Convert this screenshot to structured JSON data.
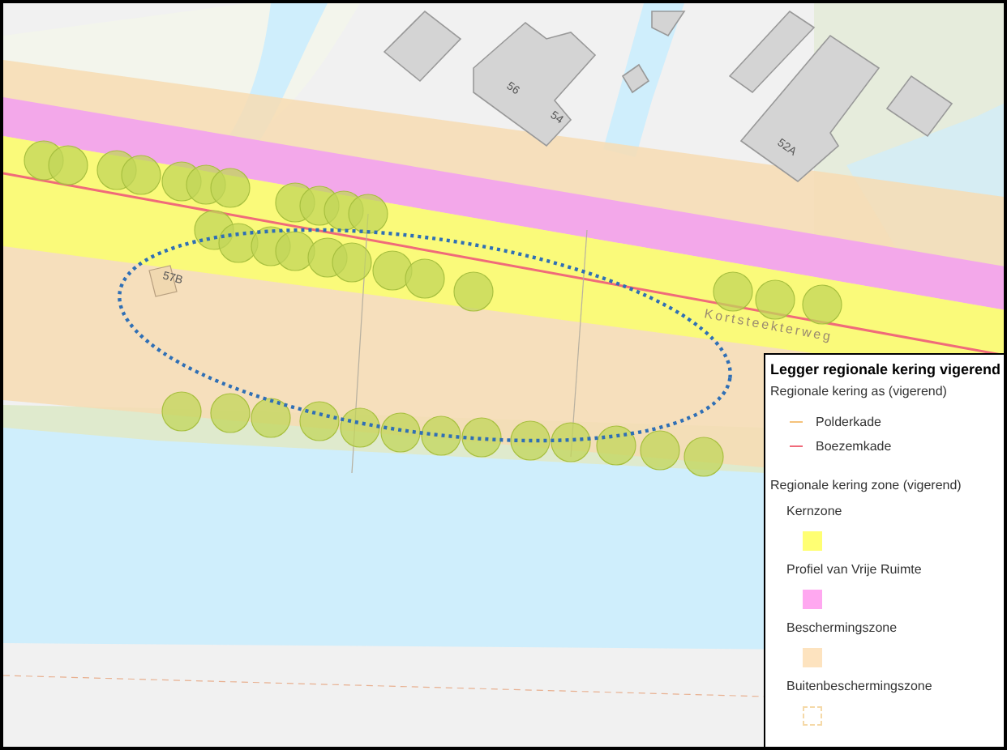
{
  "map": {
    "labels": [
      {
        "kind": "house",
        "text": "56"
      },
      {
        "kind": "house",
        "text": "54"
      },
      {
        "kind": "house",
        "text": "52A"
      },
      {
        "kind": "house",
        "text": "57B"
      },
      {
        "kind": "street",
        "text": "Kortsteekterweg"
      }
    ]
  },
  "legend": {
    "title": "Legger regionale kering vigerend",
    "groups": [
      {
        "title": "Regionale kering as (vigerend)",
        "items": [
          {
            "kind": "line",
            "label": "Polderkade",
            "color": "#f5c27a"
          },
          {
            "kind": "line",
            "label": "Boezemkade",
            "color": "#f06a7a"
          }
        ]
      },
      {
        "title": "Regionale kering zone (vigerend)",
        "items": [
          {
            "kind": "swatch",
            "label": "Kernzone",
            "color": "#ffff73"
          },
          {
            "kind": "swatch",
            "label": "Profiel van Vrije Ruimte",
            "color": "#ffa8f0"
          },
          {
            "kind": "swatch",
            "label": "Beschermingszone",
            "color": "#fde3bf"
          },
          {
            "kind": "outline",
            "label": "Buitenbeschermingszone",
            "color": "#f5d9a8"
          }
        ]
      }
    ]
  }
}
